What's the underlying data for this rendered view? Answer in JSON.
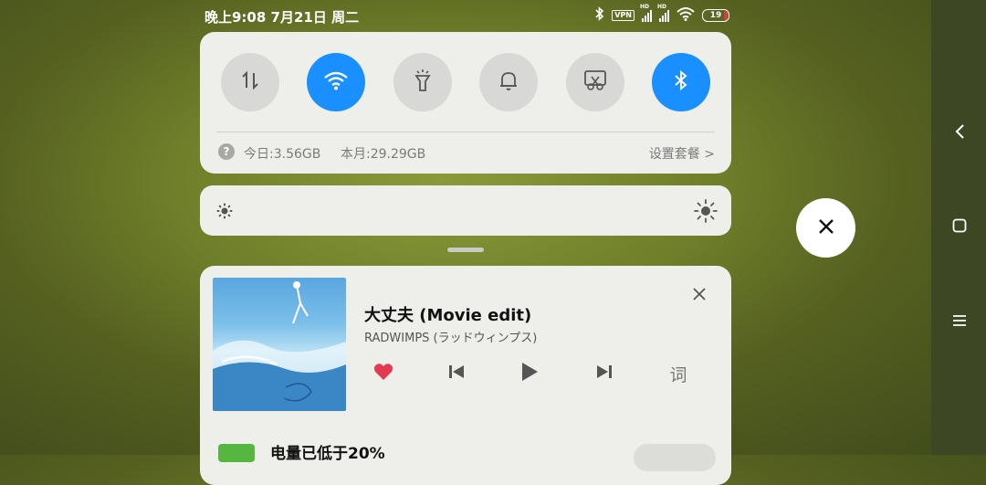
{
  "status_bar": {
    "time": "晚上9:08 7月21日 周二",
    "vpn_label": "VPN",
    "hd_label": "HD",
    "battery": "19"
  },
  "quick_settings": {
    "toggles": [
      {
        "icon": "mobile-data-icon",
        "active": false
      },
      {
        "icon": "wifi-icon",
        "active": true
      },
      {
        "icon": "flashlight-icon",
        "active": false
      },
      {
        "icon": "bell-icon",
        "active": false
      },
      {
        "icon": "screenshot-icon",
        "active": false
      },
      {
        "icon": "bluetooth-icon",
        "active": true
      }
    ],
    "help_glyph": "?",
    "data_today": "今日:3.56GB",
    "data_month": "本月:29.29GB",
    "set_plan": "设置套餐 >"
  },
  "media": {
    "title": "大丈夫 (Movie edit)",
    "artist": "RADWIMPS (ラッドウィンプス)",
    "lyrics_label": "词",
    "liked": true
  },
  "notification": {
    "text": "电量已低于20%"
  },
  "colors": {
    "accent": "#1a8fff",
    "card": "#eeefeb",
    "heart": "#e53950"
  }
}
